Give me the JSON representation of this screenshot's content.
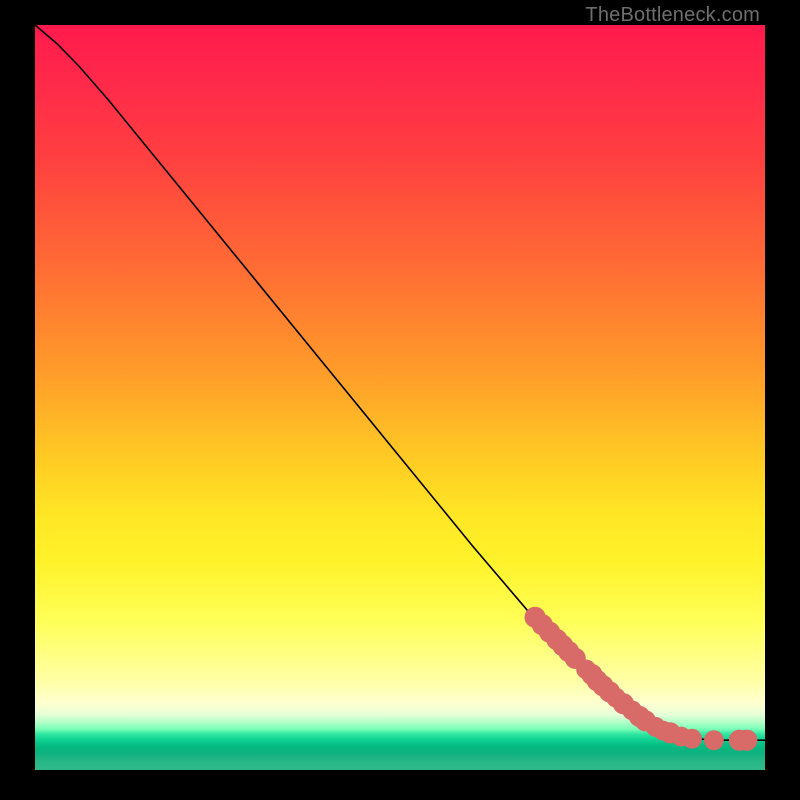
{
  "watermark": "TheBottleneck.com",
  "colors": {
    "dot": "#d86a67",
    "curve": "#000000",
    "frame": "#000000"
  },
  "chart_data": {
    "type": "line",
    "title": "",
    "xlabel": "",
    "ylabel": "",
    "xlim": [
      0,
      100
    ],
    "ylim": [
      0,
      100
    ],
    "grid": false,
    "legend": false,
    "curve_points": [
      {
        "x": 0,
        "y": 100
      },
      {
        "x": 3,
        "y": 97.5
      },
      {
        "x": 6,
        "y": 94.5
      },
      {
        "x": 10,
        "y": 90
      },
      {
        "x": 20,
        "y": 78
      },
      {
        "x": 30,
        "y": 66
      },
      {
        "x": 40,
        "y": 54
      },
      {
        "x": 50,
        "y": 42
      },
      {
        "x": 60,
        "y": 30
      },
      {
        "x": 70,
        "y": 18.5
      },
      {
        "x": 78,
        "y": 10
      },
      {
        "x": 82,
        "y": 7
      },
      {
        "x": 86,
        "y": 5
      },
      {
        "x": 90,
        "y": 4.2
      },
      {
        "x": 94,
        "y": 4
      },
      {
        "x": 97,
        "y": 4
      },
      {
        "x": 100,
        "y": 4
      }
    ],
    "dots": [
      {
        "x": 68.5,
        "y": 20.5,
        "r": 1.0
      },
      {
        "x": 69.5,
        "y": 19.5,
        "r": 1.0
      },
      {
        "x": 70.5,
        "y": 18.5,
        "r": 1.0
      },
      {
        "x": 71.5,
        "y": 17.5,
        "r": 1.0
      },
      {
        "x": 72.3,
        "y": 16.7,
        "r": 1.0
      },
      {
        "x": 73.1,
        "y": 15.9,
        "r": 1.0
      },
      {
        "x": 74.0,
        "y": 15.0,
        "r": 1.0
      },
      {
        "x": 75.5,
        "y": 13.5,
        "r": 0.9
      },
      {
        "x": 76.3,
        "y": 12.8,
        "r": 1.0
      },
      {
        "x": 77.0,
        "y": 12.0,
        "r": 1.0
      },
      {
        "x": 77.8,
        "y": 11.3,
        "r": 1.0
      },
      {
        "x": 78.7,
        "y": 10.5,
        "r": 1.0
      },
      {
        "x": 79.6,
        "y": 9.7,
        "r": 0.9
      },
      {
        "x": 80.6,
        "y": 8.9,
        "r": 1.0
      },
      {
        "x": 81.8,
        "y": 8.0,
        "r": 0.9
      },
      {
        "x": 82.8,
        "y": 7.2,
        "r": 1.0
      },
      {
        "x": 83.6,
        "y": 6.6,
        "r": 1.0
      },
      {
        "x": 85.0,
        "y": 5.8,
        "r": 0.9
      },
      {
        "x": 86.0,
        "y": 5.3,
        "r": 0.9
      },
      {
        "x": 87.0,
        "y": 5.0,
        "r": 1.0
      },
      {
        "x": 88.5,
        "y": 4.5,
        "r": 0.9
      },
      {
        "x": 90.0,
        "y": 4.2,
        "r": 0.9
      },
      {
        "x": 93.0,
        "y": 4.0,
        "r": 0.9
      },
      {
        "x": 96.5,
        "y": 4.0,
        "r": 1.0
      },
      {
        "x": 97.5,
        "y": 4.0,
        "r": 1.0
      }
    ]
  }
}
